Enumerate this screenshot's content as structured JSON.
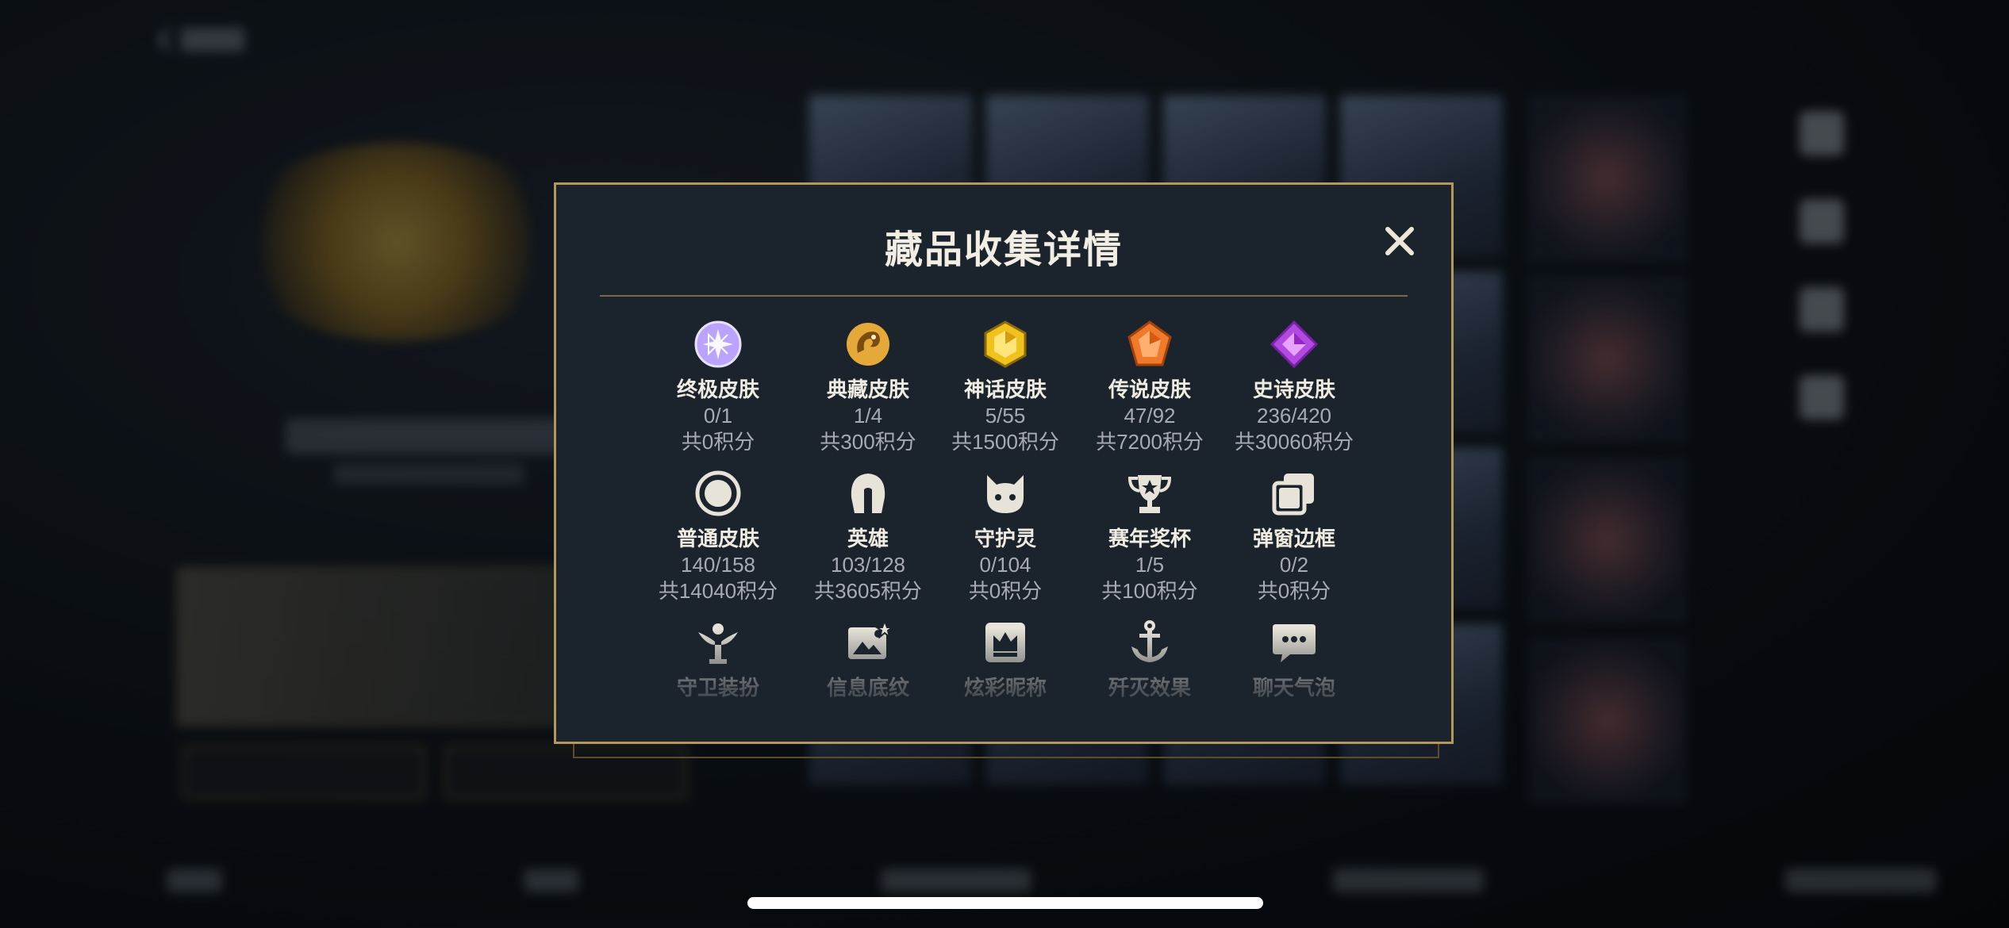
{
  "modal": {
    "title": "藏品收集详情",
    "close_label": "✕"
  },
  "rows": [
    [
      {
        "name": "终极皮肤",
        "count": "0/1",
        "points": "共0积分",
        "icon": "ultimate-skin-gem-icon",
        "color": "#b9a3ff"
      },
      {
        "name": "典藏皮肤",
        "count": "1/4",
        "points": "共300积分",
        "icon": "treasure-skin-dragon-icon",
        "color": "#e5a93a"
      },
      {
        "name": "神话皮肤",
        "count": "5/55",
        "points": "共1500积分",
        "icon": "mythic-skin-gem-icon",
        "color": "#f0c21e"
      },
      {
        "name": "传说皮肤",
        "count": "47/92",
        "points": "共7200积分",
        "icon": "legend-skin-gem-icon",
        "color": "#f07a2a"
      },
      {
        "name": "史诗皮肤",
        "count": "236/420",
        "points": "共30060积分",
        "icon": "epic-skin-gem-icon",
        "color": "#b34ae0"
      }
    ],
    [
      {
        "name": "普通皮肤",
        "count": "140/158",
        "points": "共14040积分",
        "icon": "normal-skin-circle-icon",
        "color": "#e7e3d8"
      },
      {
        "name": "英雄",
        "count": "103/128",
        "points": "共3605积分",
        "icon": "hero-helmet-icon",
        "color": "#e7e3d8"
      },
      {
        "name": "守护灵",
        "count": "0/104",
        "points": "共0积分",
        "icon": "guardian-spirit-icon",
        "color": "#e7e3d8"
      },
      {
        "name": "赛年奖杯",
        "count": "1/5",
        "points": "共100积分",
        "icon": "season-trophy-icon",
        "color": "#e7e3d8"
      },
      {
        "name": "弹窗边框",
        "count": "0/2",
        "points": "共0积分",
        "icon": "popup-frame-icon",
        "color": "#e7e3d8"
      }
    ],
    [
      {
        "name": "守卫装扮",
        "icon": "ward-skin-icon",
        "color": "#e7e3d8"
      },
      {
        "name": "信息底纹",
        "icon": "info-background-icon",
        "color": "#e7e3d8"
      },
      {
        "name": "炫彩昵称",
        "icon": "colorful-nickname-icon",
        "color": "#e7e3d8"
      },
      {
        "name": "歼灭效果",
        "icon": "elimination-effect-icon",
        "color": "#e7e3d8"
      },
      {
        "name": "聊天气泡",
        "icon": "chat-bubble-icon",
        "color": "#e7e3d8"
      }
    ]
  ],
  "colors": {
    "modal_bg": "#1b232c",
    "modal_border": "#b4975a",
    "text_primary": "#f0ece2",
    "text_secondary": "#a8acb2"
  }
}
